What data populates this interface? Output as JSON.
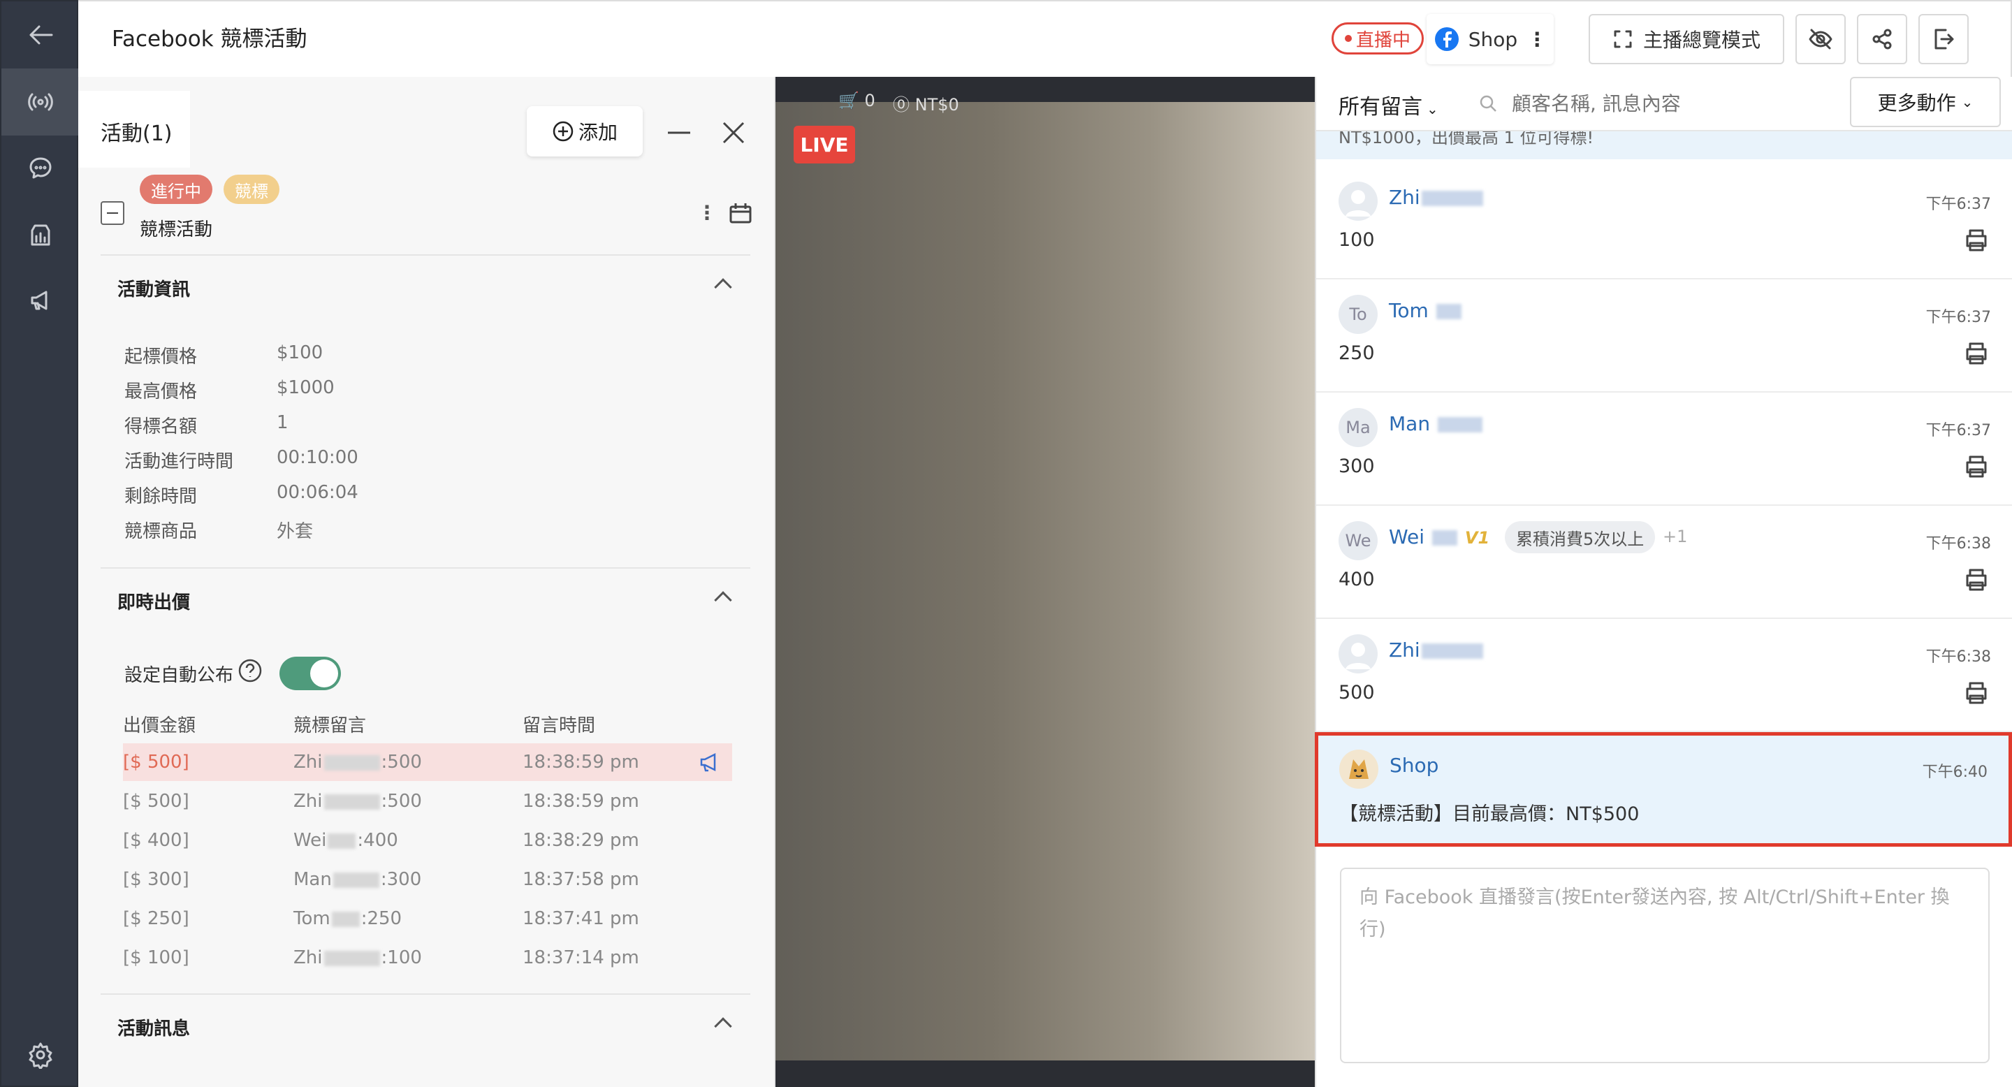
{
  "header": {
    "title": "Facebook 競標活動",
    "live_badge": "直播中",
    "shop_label": "Shop",
    "overview_label": "主播總覽模式"
  },
  "panel": {
    "title": "活動(1)",
    "add_label": "添加",
    "activity": {
      "status_tag": "進行中",
      "type_tag": "競標",
      "name": "競標活動"
    },
    "info_section": {
      "title": "活動資訊",
      "rows": [
        {
          "key": "起標價格",
          "value": "$100"
        },
        {
          "key": "最高價格",
          "value": "$1000"
        },
        {
          "key": "得標名額",
          "value": "1"
        },
        {
          "key": "活動進行時間",
          "value": "00:10:00"
        },
        {
          "key": "剩餘時間",
          "value": "00:06:04"
        },
        {
          "key": "競標商品",
          "value": "外套"
        }
      ]
    },
    "bid_section": {
      "title": "即時出價",
      "auto_publish_label": "設定自動公布",
      "auto_publish_on": true,
      "columns": [
        "出價金額",
        "競標留言",
        "留言時間"
      ],
      "rows": [
        {
          "amount": "[$ 500]",
          "name": "Zhi",
          "msg": ":500",
          "time": "18:38:59 pm",
          "highlight": true
        },
        {
          "amount": "[$ 500]",
          "name": "Zhi",
          "msg": ":500",
          "time": "18:38:59 pm",
          "highlight": false
        },
        {
          "amount": "[$ 400]",
          "name": "Wei",
          "msg": ":400",
          "time": "18:38:29 pm",
          "highlight": false
        },
        {
          "amount": "[$ 300]",
          "name": "Man",
          "msg": ":300",
          "time": "18:37:58 pm",
          "highlight": false
        },
        {
          "amount": "[$ 250]",
          "name": "Tom",
          "msg": ":250",
          "time": "18:37:41 pm",
          "highlight": false
        },
        {
          "amount": "[$ 100]",
          "name": "Zhi",
          "msg": ":100",
          "time": "18:37:14 pm",
          "highlight": false
        }
      ]
    },
    "message_section": {
      "title": "活動訊息"
    }
  },
  "video": {
    "cart_count": "0",
    "price": "NT$0",
    "live_label": "LIVE"
  },
  "comments": {
    "filter_label": "所有留言",
    "search_placeholder": "顧客名稱, 訊息內容",
    "more_label": "更多動作",
    "notice_text": "NT$1000，出價最高 1 位可得標!",
    "items": [
      {
        "avatar": "",
        "name": "Zhi",
        "time": "下午6:37",
        "msg": "100"
      },
      {
        "avatar": "To",
        "name": "Tom",
        "time": "下午6:37",
        "msg": "250"
      },
      {
        "avatar": "Ma",
        "name": "Man",
        "time": "下午6:37",
        "msg": "300"
      },
      {
        "avatar": "We",
        "name": "Wei",
        "time": "下午6:38",
        "msg": "400",
        "vip": "V1",
        "tag": "累積消費5次以上",
        "extra": "+1"
      },
      {
        "avatar": "",
        "name": "Zhi",
        "time": "下午6:38",
        "msg": "500"
      }
    ],
    "shop_item": {
      "name": "Shop",
      "time": "下午6:40",
      "msg": "【競標活動】目前最高價：NT$500"
    },
    "input_placeholder": "向 Facebook 直播發言(按Enter發送內容, 按 Alt/Ctrl/Shift+Enter 換行)"
  },
  "colors": {
    "rail": "#323844",
    "accent_red": "#e0443b",
    "link_blue": "#2b6ab3",
    "toggle_green": "#4f9b7c",
    "highlight_border": "#e03a2c"
  }
}
